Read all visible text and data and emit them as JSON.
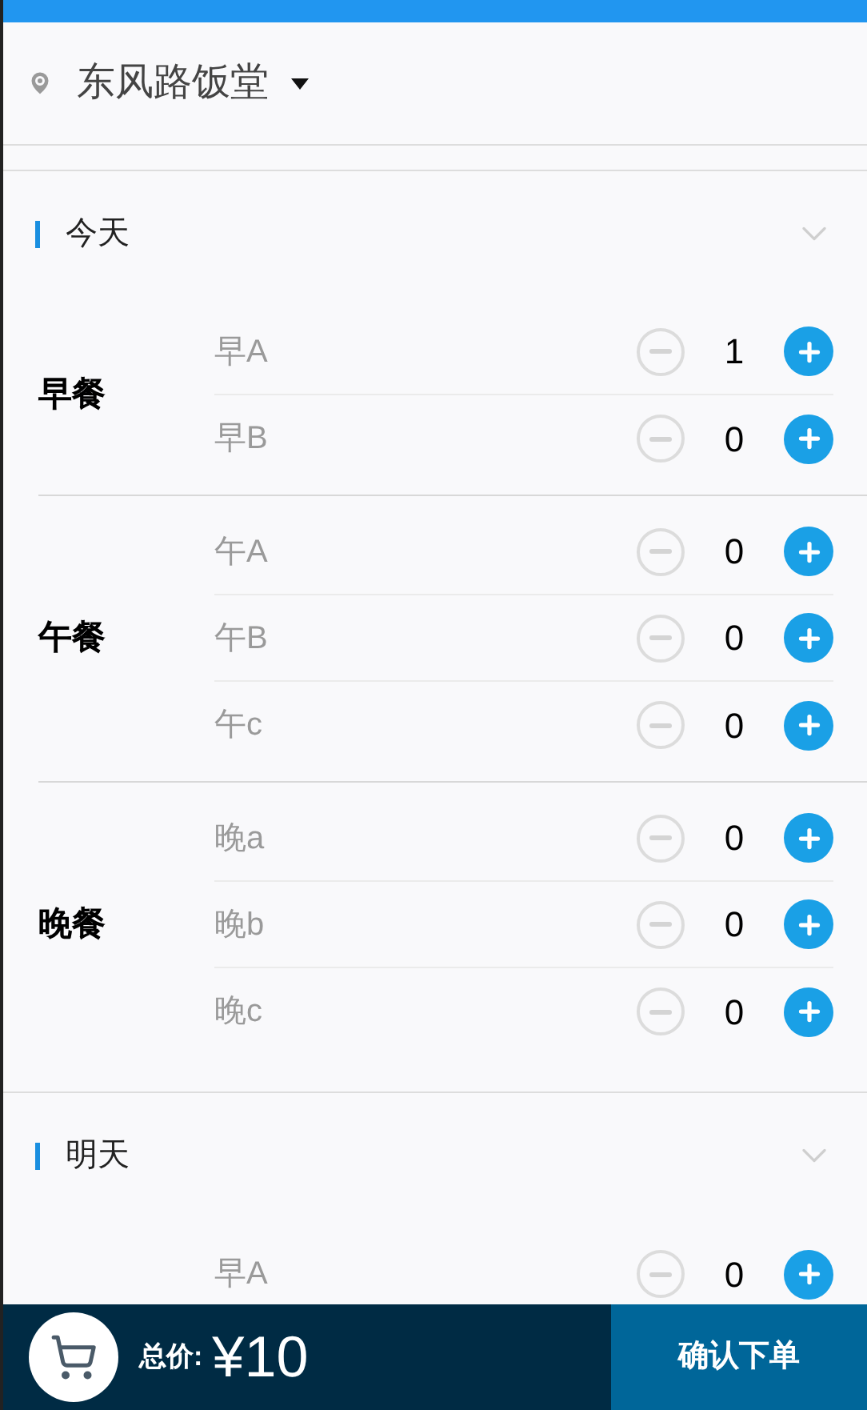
{
  "location": "东风路饭堂",
  "days": [
    {
      "label": "今天",
      "meals": [
        {
          "name": "早餐",
          "items": [
            {
              "name": "早A",
              "count": "1"
            },
            {
              "name": "早B",
              "count": "0"
            }
          ]
        },
        {
          "name": "午餐",
          "items": [
            {
              "name": "午A",
              "count": "0"
            },
            {
              "name": "午B",
              "count": "0"
            },
            {
              "name": "午c",
              "count": "0"
            }
          ]
        },
        {
          "name": "晚餐",
          "items": [
            {
              "name": "晚a",
              "count": "0"
            },
            {
              "name": "晚b",
              "count": "0"
            },
            {
              "name": "晚c",
              "count": "0"
            }
          ]
        }
      ]
    },
    {
      "label": "明天",
      "meals": [
        {
          "items": [
            {
              "name": "早A",
              "count": "0"
            }
          ]
        }
      ]
    }
  ],
  "footer": {
    "total_label": "总价:",
    "total": "¥10",
    "confirm": "确认下单"
  }
}
